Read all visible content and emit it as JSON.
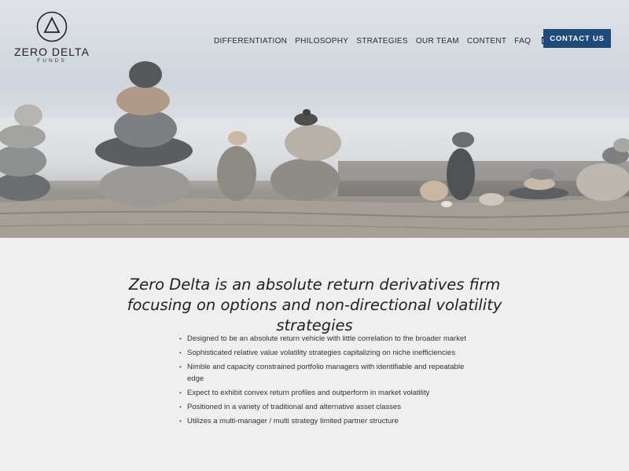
{
  "brand": {
    "name": "ZERO DELTA",
    "sub": "FUNDS",
    "logo_icon": "triangle-in-circle-icon"
  },
  "nav": {
    "items": [
      {
        "label": "DIFFERENTIATION"
      },
      {
        "label": "PHILOSOPHY"
      },
      {
        "label": "STRATEGIES"
      },
      {
        "label": "OUR TEAM"
      },
      {
        "label": "CONTENT"
      },
      {
        "label": "FAQ"
      }
    ],
    "mail_icon": "envelope-icon",
    "contact_label": "CONTACT US"
  },
  "hero": {
    "image": "stacked-stones-on-driftwood-beach"
  },
  "main": {
    "headline": "Zero Delta is an absolute return derivatives firm focusing on options and non-directional volatility strategies",
    "bullets": [
      "Designed to be an absolute return vehicle with little correlation to the broader market",
      "Sophisticated relative value volatility strategies capitalizing on niche inefficiencies",
      "Nimble and capacity constrained portfolio managers with identifiable and repeatable edge",
      "Expect to exhibit convex return profiles and outperform in market volatility",
      "Positioned in a variety of traditional and alternative asset classes",
      "Utilizes a multi-manager / multi strategy limited partner structure"
    ]
  },
  "colors": {
    "accent": "#1e4b79",
    "background": "#efefef",
    "text": "#333333"
  }
}
